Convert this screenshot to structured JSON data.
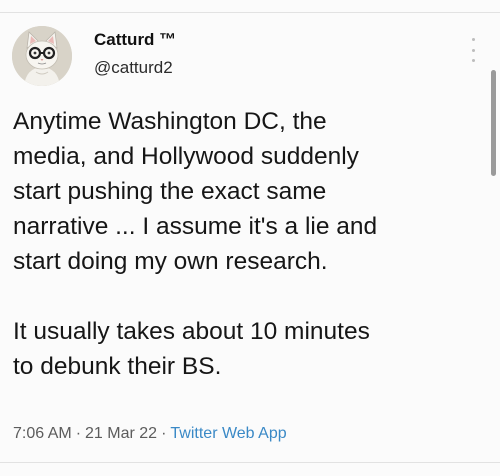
{
  "tweet": {
    "author": {
      "display_name": "Catturd ™",
      "handle": "@catturd2"
    },
    "text": "Anytime Washington DC, the\nmedia, and Hollywood suddenly\nstart pushing the exact same\nnarrative ... I assume it's a lie and\nstart doing my own research.\n\nIt usually takes about 10 minutes\nto debunk their BS.",
    "time": "7:06 AM",
    "date": "21 Mar 22",
    "source": "Twitter Web App",
    "separator": "·"
  },
  "colors": {
    "link": "#3a89c6",
    "meta_text": "#5c5c5c",
    "background": "#fbfbfb"
  },
  "icons": {
    "more": "vertical-dots-icon",
    "avatar": "cat-avatar-icon"
  }
}
